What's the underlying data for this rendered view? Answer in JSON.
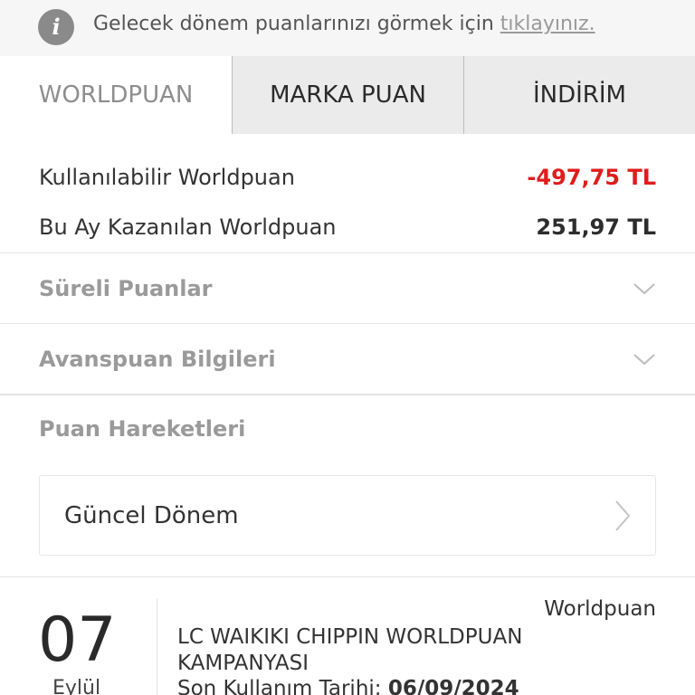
{
  "info": {
    "text": "Gelecek dönem puanlarınızı görmek için ",
    "link": "tıklayınız.",
    "icon": "info-icon"
  },
  "tabs": [
    {
      "label": "WORLDPUAN",
      "active": true
    },
    {
      "label": "MARKA PUAN",
      "active": false
    },
    {
      "label": "İNDİRİM",
      "active": false
    }
  ],
  "summary": {
    "available_label": "Kullanılabilir Worldpuan",
    "available_value": "-497,75 TL",
    "earned_label": "Bu Ay Kazanılan Worldpuan",
    "earned_value": "251,97 TL"
  },
  "sections": {
    "timed_points": "Süreli Puanlar",
    "advance_points": "Avanspuan Bilgileri",
    "point_movements": "Puan Hareketleri"
  },
  "period": {
    "label": "Güncel Dönem"
  },
  "entry": {
    "day": "07",
    "month": "Eylül",
    "type": "Worldpuan",
    "title": "LC WAIKIKI CHIPPIN WORLDPUAN KAMPANYASI",
    "date_label": "Son Kullanım Tarihi: ",
    "date_value": "06/09/2024"
  },
  "colors": {
    "negative": "#e01c1c",
    "muted": "#9a9a9a"
  }
}
